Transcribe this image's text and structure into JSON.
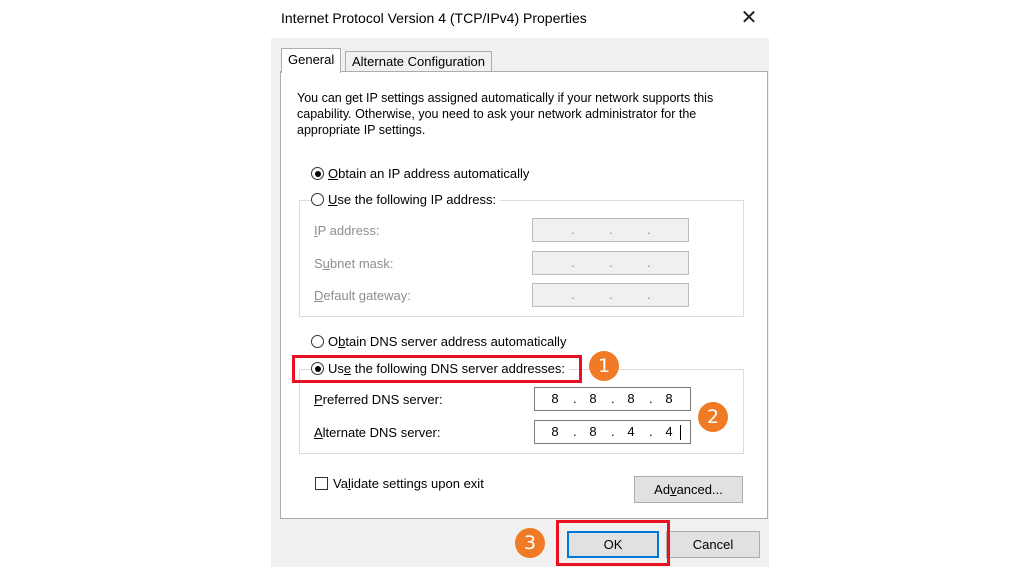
{
  "window": {
    "title": "Internet Protocol Version 4 (TCP/IPv4) Properties",
    "close_glyph": "✕"
  },
  "tabs": [
    {
      "label": "General",
      "active": true
    },
    {
      "label": "Alternate Configuration",
      "active": false
    }
  ],
  "description": "You can get IP settings assigned automatically if your network supports this capability. Otherwise, you need to ask your network administrator for the appropriate IP settings.",
  "ip_section": {
    "auto_option": {
      "pre": "",
      "key": "O",
      "post": "btain an IP address automatically",
      "selected": true
    },
    "manual_option": {
      "pre": "",
      "key": "U",
      "post": "se the following IP address:",
      "selected": false
    },
    "fields": [
      {
        "pre": "",
        "key": "I",
        "post": "P address:",
        "value": [
          ".",
          ".",
          "."
        ],
        "enabled": false
      },
      {
        "pre": "S",
        "key": "u",
        "post": "bnet mask:",
        "value": [
          ".",
          ".",
          "."
        ],
        "enabled": false
      },
      {
        "pre": "",
        "key": "D",
        "post": "efault gateway:",
        "value": [
          ".",
          ".",
          "."
        ],
        "enabled": false
      }
    ]
  },
  "dns_section": {
    "auto_option": {
      "pre": "O",
      "key": "b",
      "post": "tain DNS server address automatically",
      "selected": false
    },
    "manual_option": {
      "pre": "Us",
      "key": "e",
      "post": " the following DNS server addresses:",
      "selected": true
    },
    "preferred": {
      "pre": "",
      "key": "P",
      "post": "referred DNS server:",
      "octets": [
        "8",
        "8",
        "8",
        "8"
      ]
    },
    "alternate": {
      "pre": "",
      "key": "A",
      "post": "lternate DNS server:",
      "octets": [
        "8",
        "8",
        "4",
        "4"
      ]
    }
  },
  "validate": {
    "pre": "Va",
    "key": "l",
    "post": "idate settings upon exit",
    "checked": false
  },
  "buttons": {
    "advanced": {
      "pre": "Ad",
      "key": "v",
      "post": "anced..."
    },
    "ok": "OK",
    "cancel": "Cancel"
  },
  "annotations": {
    "step1": "1",
    "step2": "2",
    "step3": "3",
    "highlight_color": "#e81123",
    "badge_color": "#f07a25"
  },
  "colors": {
    "dialog_bg": "#f0f0f0",
    "focus_border": "#0078d7",
    "disabled_text": "#8e8e8e"
  }
}
